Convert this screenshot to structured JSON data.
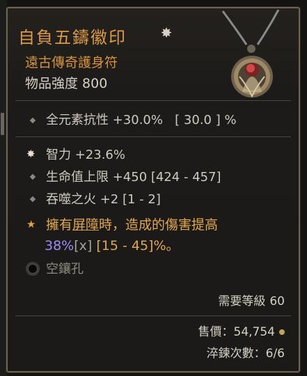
{
  "item": {
    "name": "自負五鑄徽印",
    "type_label": "遠古傳奇護身符",
    "power_label": "物品強度",
    "power_value": "800"
  },
  "implicit": {
    "stat": "全元素抗性 +30.0%",
    "range": "[ 30.0 ] %"
  },
  "affixes": [
    {
      "text": "智力 +23.6%",
      "bullet": "greater-affix-star-icon"
    },
    {
      "text": "生命值上限 +450 [424 - 457]",
      "bullet": "diamond-icon"
    },
    {
      "text": "吞噬之火 +2 [1 - 2]",
      "bullet": "diamond-icon"
    }
  ],
  "aspect": {
    "prefix": "擁有",
    "keyword": "屏障",
    "suffix": "時，造成的傷害提高",
    "value": "38%",
    "marker": "[x]",
    "range": "[15 - 45]%。"
  },
  "socket": {
    "label": "空鑲孔"
  },
  "requirement": {
    "label": "需要等級",
    "value": "60"
  },
  "sell": {
    "text": "售價：54,754"
  },
  "temper": {
    "text": "淬鍊次數：6/6"
  },
  "colors": {
    "legendary_orange": "#dd9a45",
    "aspect_value_blue": "#9c8bf2",
    "text_main": "#d6d0c5"
  }
}
